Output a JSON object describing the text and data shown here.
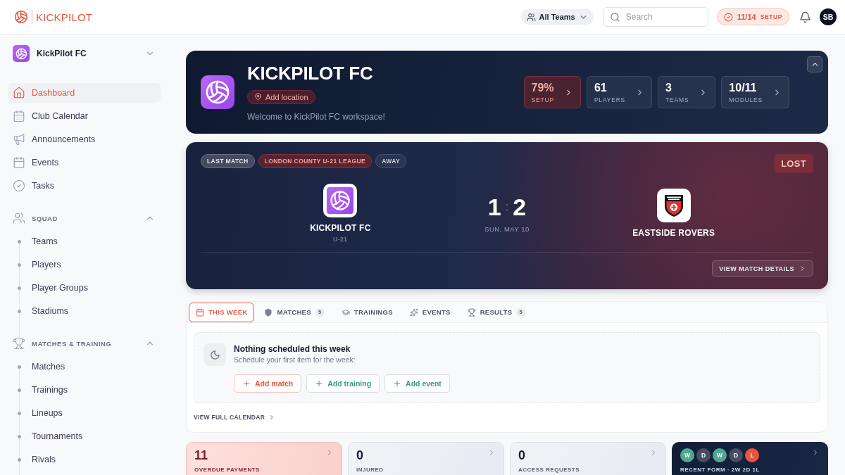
{
  "topbar": {
    "logo": "KICKPILOT",
    "team_filter": "All Teams",
    "search": {
      "placeholder": "Search"
    },
    "setup": {
      "progress": "11/14",
      "label": "SETUP"
    },
    "avatar": "SB"
  },
  "sidebar": {
    "club": "KickPilot FC",
    "items": [
      {
        "label": "Dashboard",
        "selected": true
      },
      {
        "label": "Club Calendar",
        "selected": false
      },
      {
        "label": "Announcements",
        "selected": false
      },
      {
        "label": "Events",
        "selected": false
      },
      {
        "label": "Tasks",
        "selected": false
      }
    ],
    "sections": [
      {
        "title": "SQUAD",
        "expanded": true,
        "items": [
          {
            "label": "Teams",
            "selected": false
          },
          {
            "label": "Players",
            "selected": false
          },
          {
            "label": "Player Groups",
            "selected": false
          },
          {
            "label": "Stadiums",
            "selected": false
          }
        ]
      },
      {
        "title": "MATCHES & TRAINING",
        "expanded": true,
        "items": [
          {
            "label": "Matches",
            "selected": false
          },
          {
            "label": "Trainings",
            "selected": false
          },
          {
            "label": "Lineups",
            "selected": false
          },
          {
            "label": "Tournaments",
            "selected": false
          },
          {
            "label": "Rivals",
            "selected": false
          }
        ]
      }
    ]
  },
  "hero": {
    "title": "KICKPILOT FC",
    "location_button": "Add location",
    "welcome": "Welcome to KickPilot FC workspace!",
    "stats": [
      {
        "value": "79%",
        "label": "SETUP",
        "kind": "alert"
      },
      {
        "value": "61",
        "label": "PLAYERS",
        "kind": "default"
      },
      {
        "value": "3",
        "label": "TEAMS",
        "kind": "default"
      },
      {
        "value": "10/11",
        "label": "MODULES",
        "kind": "default"
      }
    ]
  },
  "last_match": {
    "tags": [
      {
        "label": "LAST MATCH",
        "kind": "neutral"
      },
      {
        "label": "LONDON COUNTY U-21 LEAGUE",
        "kind": "competition"
      },
      {
        "label": "AWAY",
        "kind": "venue"
      }
    ],
    "result": {
      "label": "LOST",
      "kind": "loss"
    },
    "home": {
      "name": "KICKPILOT FC",
      "team": "U-21"
    },
    "score": {
      "home": "1",
      "separator": ":",
      "away": "2"
    },
    "date": "SUN, MAY 10",
    "away": {
      "name": "EASTSIDE ROVERS"
    },
    "details_button": "VIEW MATCH DETAILS"
  },
  "schedule": {
    "tabs": [
      {
        "label": "THIS WEEK",
        "selected": true
      },
      {
        "label": "MATCHES",
        "count": "5",
        "selected": false
      },
      {
        "label": "TRAININGS",
        "selected": false
      },
      {
        "label": "EVENTS",
        "selected": false
      },
      {
        "label": "RESULTS",
        "count": "5",
        "selected": false
      }
    ],
    "empty_state": {
      "title": "Nothing scheduled this week",
      "subtitle": "Schedule your first item for the week:",
      "actions": [
        {
          "label": "Add match",
          "kind": "match"
        },
        {
          "label": "Add training",
          "kind": "training"
        },
        {
          "label": "Add event",
          "kind": "event"
        }
      ]
    },
    "calendar_link": "VIEW FULL CALENDAR"
  },
  "summary_cards": [
    {
      "kind": "alert",
      "value": "11",
      "label": "OVERDUE PAYMENTS"
    },
    {
      "kind": "default",
      "value": "0",
      "label": "INJURED"
    },
    {
      "kind": "default",
      "value": "0",
      "label": "ACCESS REQUESTS"
    },
    {
      "kind": "form",
      "form": [
        {
          "result": "W",
          "color": "#4fa98f"
        },
        {
          "result": "D",
          "color": "#474d63"
        },
        {
          "result": "W",
          "color": "#4fa98f"
        },
        {
          "result": "D",
          "color": "#474d63"
        },
        {
          "result": "L",
          "color": "#e8553e"
        }
      ],
      "label": "RECENT FORM · 2W 2D 1L"
    }
  ]
}
